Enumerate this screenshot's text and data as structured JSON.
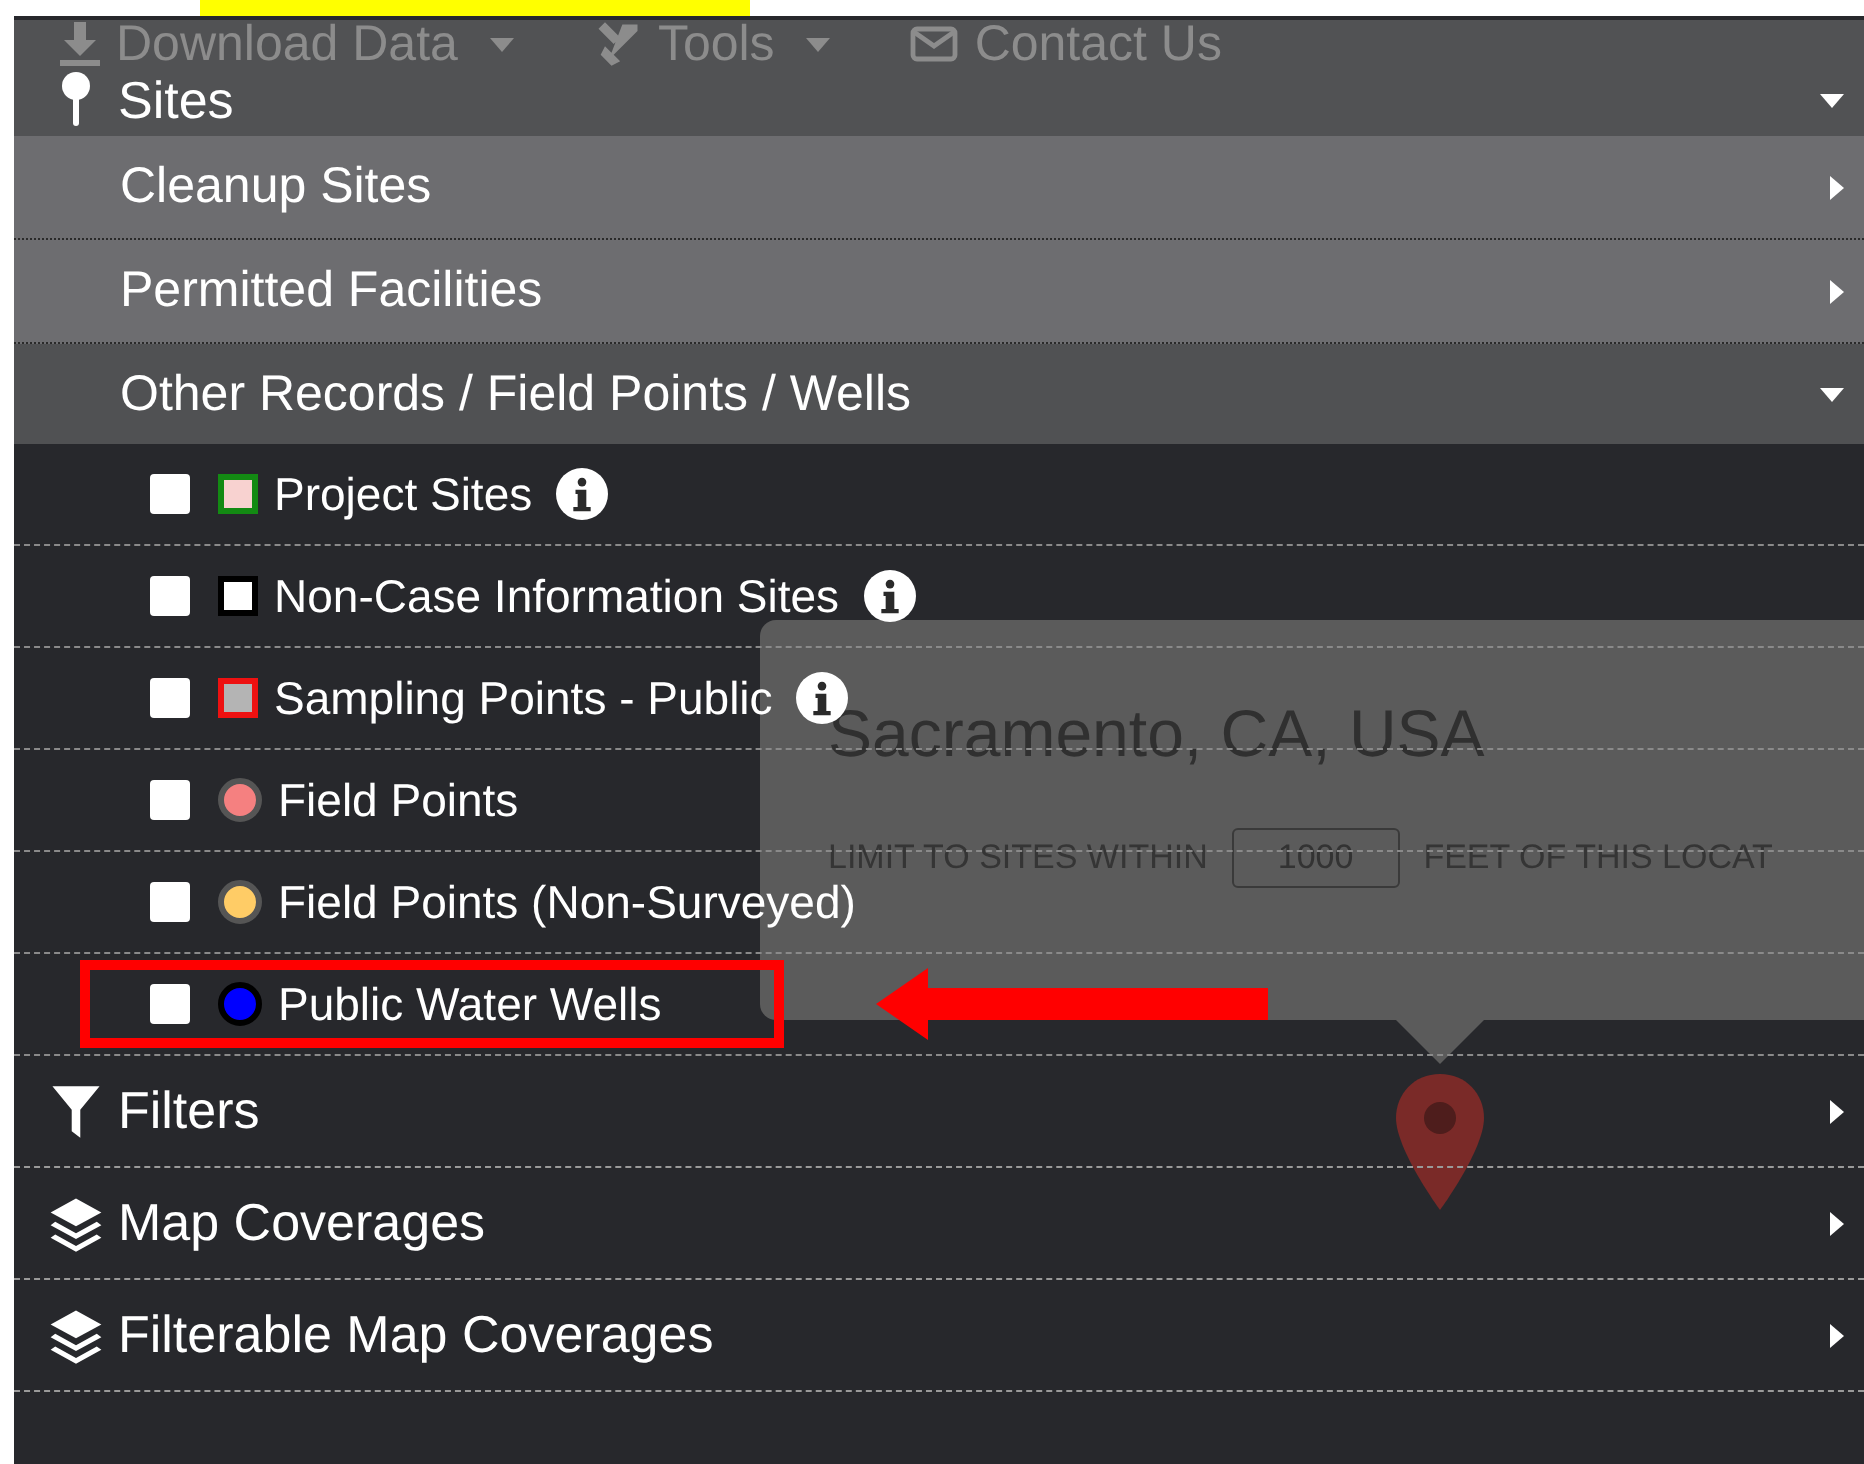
{
  "top_nav": [
    {
      "label": "Download Data",
      "kind": "download",
      "dropdown": true
    },
    {
      "label": "Tools",
      "kind": "tools",
      "dropdown": true
    },
    {
      "label": "Contact Us",
      "kind": "mail",
      "dropdown": false
    }
  ],
  "popup": {
    "title": "Sacramento, CA, USA",
    "limit_label": "LIMIT TO SITES WITHIN",
    "distance": "1000",
    "suffix": "FEET OF THIS LOCAT"
  },
  "panel": {
    "sections": [
      {
        "label": "Sites",
        "kind": "pin",
        "expanded": true,
        "children": [
          {
            "label": "Cleanup Sites",
            "expanded": false
          },
          {
            "label": "Permitted Facilities",
            "expanded": false
          },
          {
            "label": "Other Records / Field Points / Wells",
            "expanded": true,
            "layers": [
              {
                "label": "Project Sites",
                "checked": false,
                "kind": "square",
                "color": "#f8d2d0",
                "outline": {
                  "color": "#138a13"
                },
                "info": true,
                "highlighted": false
              },
              {
                "label": "Non-Case Information Sites",
                "checked": false,
                "kind": "square",
                "color": "#ffffff",
                "outline": {
                  "color": "#000000"
                },
                "info": true,
                "highlighted": false
              },
              {
                "label": "Sampling Points - Public",
                "checked": false,
                "kind": "square",
                "color": "#b4b4b4",
                "outline": {
                  "color": "#ee1111"
                },
                "info": true,
                "highlighted": false
              },
              {
                "label": "Field Points",
                "checked": false,
                "kind": "circle",
                "color": "#f58080",
                "outline": {
                  "color": "#555555"
                },
                "info": false,
                "highlighted": false
              },
              {
                "label": "Field Points (Non-Surveyed)",
                "checked": false,
                "kind": "circle",
                "color": "#ffcc66",
                "outline": {
                  "color": "#555555"
                },
                "info": false,
                "highlighted": false
              },
              {
                "label": "Public Water Wells",
                "checked": false,
                "kind": "circle",
                "color": "#0000ff",
                "outline": {
                  "color": "#000000"
                },
                "info": false,
                "highlighted": true
              }
            ]
          }
        ]
      },
      {
        "label": "Filters",
        "kind": "filter",
        "expanded": false
      },
      {
        "label": "Map Coverages",
        "kind": "layers",
        "expanded": false
      },
      {
        "label": "Filterable Map Coverages",
        "kind": "layers",
        "expanded": false
      }
    ]
  }
}
